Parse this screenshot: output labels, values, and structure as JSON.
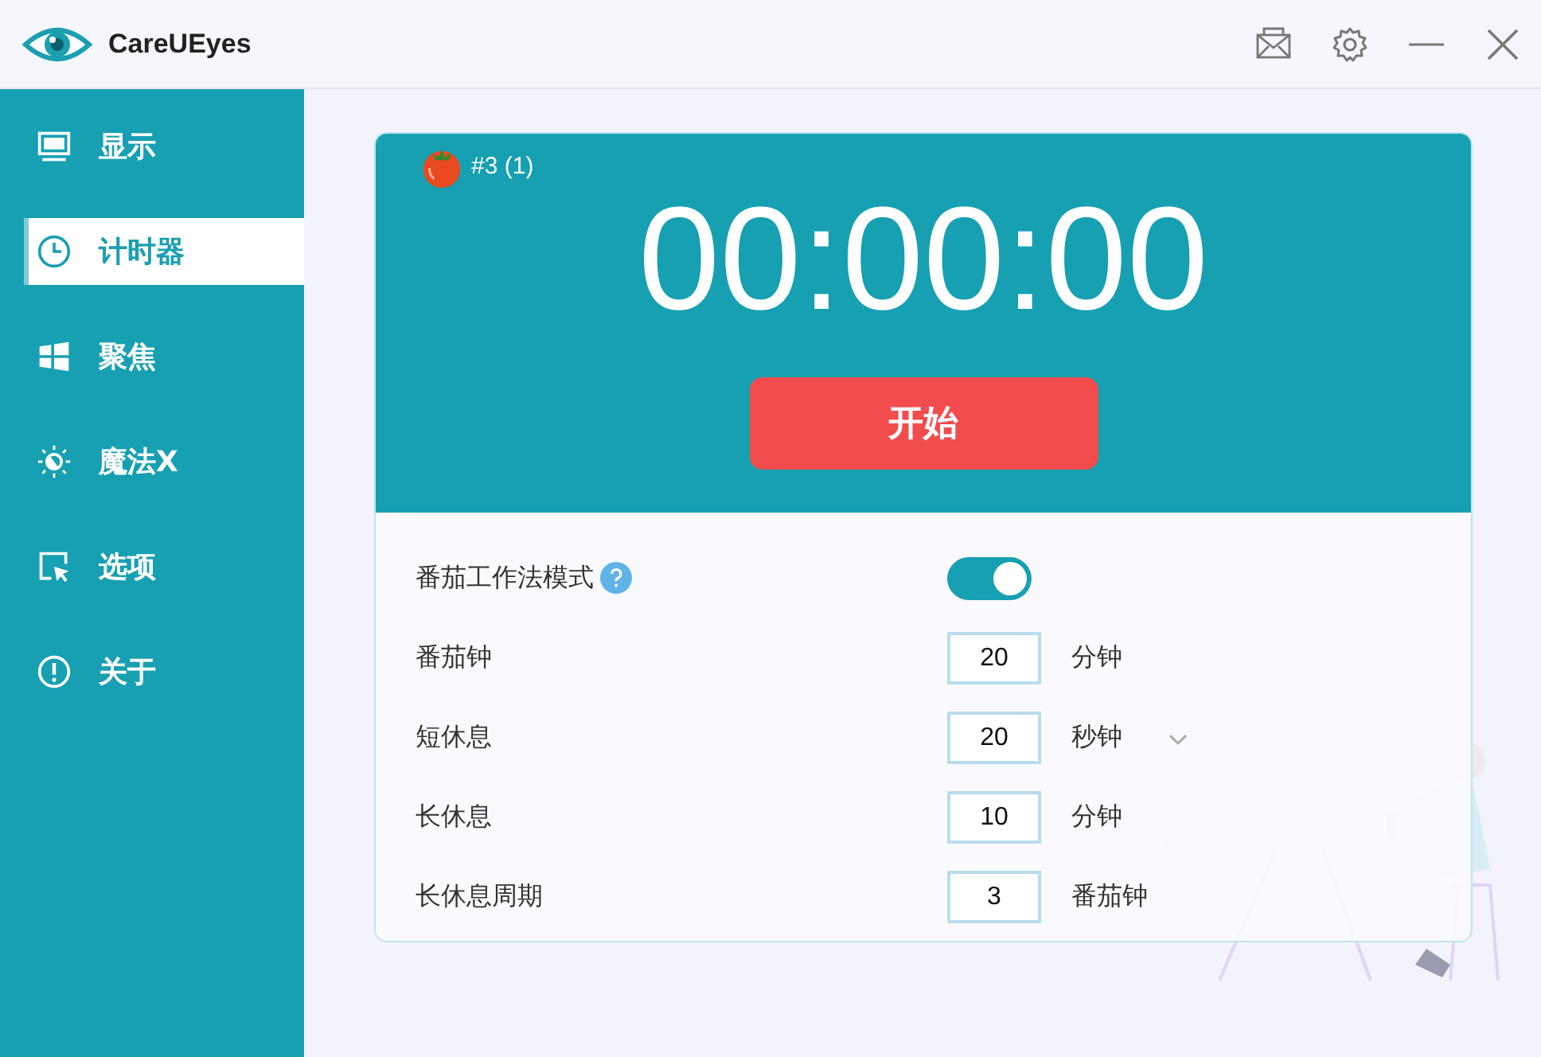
{
  "window": {
    "title": "CareUEyes"
  },
  "title_bar_buttons": [
    {
      "kind": "mail"
    },
    {
      "kind": "settings"
    },
    {
      "kind": "minimize"
    },
    {
      "kind": "close"
    }
  ],
  "sidebar": {
    "items": [
      {
        "label": "显示",
        "kind": "monitor",
        "selected": false
      },
      {
        "label": "计时器",
        "kind": "clock",
        "selected": true
      },
      {
        "label": "聚焦",
        "kind": "windows",
        "selected": false
      },
      {
        "label": "魔法X",
        "kind": "sun",
        "selected": false
      },
      {
        "label": "选项",
        "kind": "cursor",
        "selected": false
      },
      {
        "label": "关于",
        "kind": "info",
        "selected": false
      }
    ]
  },
  "timer": {
    "counter": "#3 (1)",
    "time": "00:00:00",
    "start_button": "开始"
  },
  "settings": {
    "pomodoro_mode": {
      "label": "番茄工作法模式",
      "on": true
    },
    "rows": [
      {
        "label": "番茄钟",
        "value": "20",
        "unit": "分钟",
        "has_dropdown": false
      },
      {
        "label": "短休息",
        "value": "20",
        "unit": "秒钟",
        "has_dropdown": true
      },
      {
        "label": "长休息",
        "value": "10",
        "unit": "分钟",
        "has_dropdown": false
      },
      {
        "label": "长休息周期",
        "value": "3",
        "unit": "番茄钟",
        "has_dropdown": false
      }
    ]
  }
}
